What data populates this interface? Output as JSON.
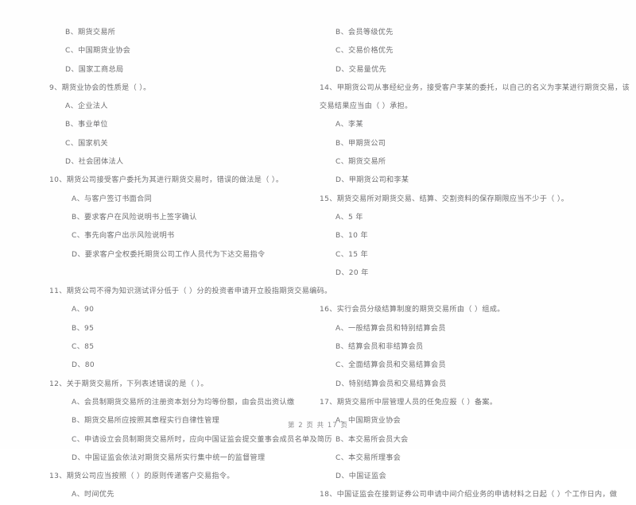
{
  "document": {
    "type": "exam-paper-scan",
    "language": "zh-CN",
    "text_color": "#6e6e70",
    "background_color": "#fefefe"
  },
  "footer": {
    "page_label": "第 2 页  共 17 页"
  },
  "left_column": {
    "lines": [
      {
        "indent": "opt",
        "text": "B、期货交易所"
      },
      {
        "indent": "opt",
        "text": "C、中国期货业协会"
      },
      {
        "indent": "opt",
        "text": "D、国家工商总局"
      },
      {
        "indent": "stem",
        "text": "9、期货业协会的性质是（      ）。"
      },
      {
        "indent": "opt",
        "text": "A、企业法人"
      },
      {
        "indent": "opt",
        "text": "B、事业单位"
      },
      {
        "indent": "opt",
        "text": "C、国家机关"
      },
      {
        "indent": "opt",
        "text": "D、社会团体法人"
      },
      {
        "indent": "stem",
        "text": "10、期货公司接受客户委托为其进行期货交易时，错误的做法是（      ）。"
      },
      {
        "indent": "deep",
        "text": "A、与客户签订书面合同"
      },
      {
        "indent": "deep",
        "text": "B、要求客户在风险说明书上签字确认"
      },
      {
        "indent": "deep",
        "text": "C、事先向客户出示风险说明书"
      },
      {
        "indent": "deep",
        "text": "D、要求客户全权委托期货公司工作人员代为下达交易指令"
      },
      {
        "indent": "spacer",
        "text": ""
      },
      {
        "indent": "stem",
        "text": "11、期货公司不得为知识测试评分低于（      ）分的投资者申请开立股指期货交易编码。"
      },
      {
        "indent": "deep",
        "text": "A、90"
      },
      {
        "indent": "deep",
        "text": "B、95"
      },
      {
        "indent": "deep",
        "text": "C、85"
      },
      {
        "indent": "deep",
        "text": "D、80"
      },
      {
        "indent": "stem",
        "text": "12、关于期货交易所，下列表述错误的是（      ）。"
      },
      {
        "indent": "deep",
        "text": "A、会员制期货交易所的注册资本划分为均等份额，由会员出资认缴"
      },
      {
        "indent": "deep",
        "text": "B、期货交易所应按照其章程实行自律性管理"
      },
      {
        "indent": "deep",
        "text": "C、申请设立会员制期货交易所时，应向中国证监会提交董事会成员名单及简历"
      },
      {
        "indent": "deep",
        "text": "D、中国证监会依法对期货交易所实行集中统一的监督管理"
      },
      {
        "indent": "stem",
        "text": "13、期货公司应当按照（      ）的原则传递客户交易指令。"
      },
      {
        "indent": "deep",
        "text": "A、时间优先"
      }
    ]
  },
  "right_column": {
    "lines": [
      {
        "indent": "opt",
        "text": "B、会员等级优先"
      },
      {
        "indent": "opt",
        "text": "C、交易价格优先"
      },
      {
        "indent": "opt",
        "text": "D、交易量优先"
      },
      {
        "indent": "stem",
        "text": "14、甲期货公司从事经纪业务，接受客户李某的委托，以自己的名义为李某进行期货交易，该"
      },
      {
        "indent": "cont",
        "text": "交易结果应当由（      ）承担。"
      },
      {
        "indent": "opt",
        "text": "A、李某"
      },
      {
        "indent": "opt",
        "text": "B、甲期货公司"
      },
      {
        "indent": "opt",
        "text": "C、期货交易所"
      },
      {
        "indent": "opt",
        "text": "D、甲期货公司和李某"
      },
      {
        "indent": "stem",
        "text": "15、期货交易所对期货交易、结算、交割资料的保存期限应当不少于（      ）。"
      },
      {
        "indent": "opt",
        "text": "A、5 年"
      },
      {
        "indent": "opt",
        "text": "B、10 年"
      },
      {
        "indent": "opt",
        "text": "C、15 年"
      },
      {
        "indent": "opt",
        "text": "D、20 年"
      },
      {
        "indent": "spacer",
        "text": ""
      },
      {
        "indent": "stem",
        "text": "16、实行会员分级结算制度的期货交易所由（      ）组成。"
      },
      {
        "indent": "opt",
        "text": "A、一般结算会员和特别结算会员"
      },
      {
        "indent": "opt",
        "text": "B、结算会员和非结算会员"
      },
      {
        "indent": "opt",
        "text": "C、全面结算会员和交易结算会员"
      },
      {
        "indent": "opt",
        "text": "D、特别结算会员和交易结算会员"
      },
      {
        "indent": "stem",
        "text": "17、期货交易所中层管理人员的任免应报（      ）备案。"
      },
      {
        "indent": "opt",
        "text": "A、中国期货业协会"
      },
      {
        "indent": "opt",
        "text": "B、本交易所会员大会"
      },
      {
        "indent": "opt",
        "text": "C、本交易所理事会"
      },
      {
        "indent": "opt",
        "text": "D、中国证监会"
      },
      {
        "indent": "stem",
        "text": "18、中国证监会在接到证券公司申请中间介绍业务的申请材料之日起（      ）个工作日内，做"
      }
    ]
  }
}
